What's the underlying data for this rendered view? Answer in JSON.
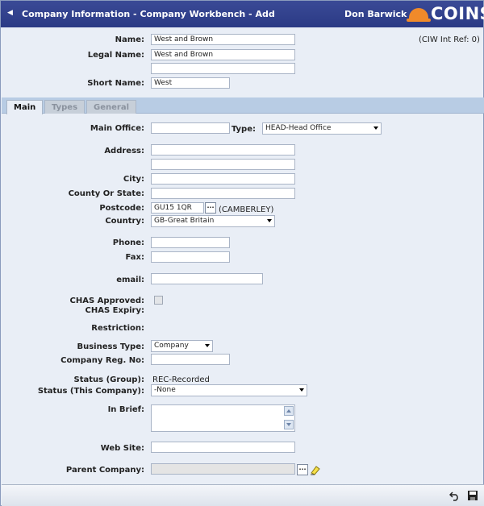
{
  "window": {
    "title": "Company Information - Company Workbench - Add",
    "user": "Don Barwick",
    "logo_text": "COINS",
    "back_icon": "left-triangle-icon"
  },
  "header_fields": {
    "name_label": "Name:",
    "name_value": "West and Brown",
    "legal_name_label": "Legal Name:",
    "legal_name_value": "West and Brown",
    "legal_name_line2": "",
    "short_name_label": "Short Name:",
    "short_name_value": "West",
    "ciw_ref": "(CIW Int Ref: 0)"
  },
  "tabs": [
    {
      "label": "Main"
    },
    {
      "label": "Types"
    },
    {
      "label": "General"
    }
  ],
  "main": {
    "main_office_label": "Main Office:",
    "main_office_value": "",
    "type_label": "Type:",
    "type_value": "HEAD-Head Office",
    "address_label": "Address:",
    "address_line1": "",
    "address_line2": "",
    "city_label": "City:",
    "city_value": "",
    "county_label": "County Or State:",
    "county_value": "",
    "postcode_label": "Postcode:",
    "postcode_value": "GU15 1QR",
    "postcode_lookup_label": "...",
    "postcode_area": "(CAMBERLEY)",
    "country_label": "Country:",
    "country_value": "GB-Great Britain",
    "phone_label": "Phone:",
    "phone_value": "",
    "fax_label": "Fax:",
    "fax_value": "",
    "email_label": "email:",
    "email_value": "",
    "chas_approved_label": "CHAS Approved:",
    "chas_approved_checked": false,
    "chas_expiry_label": "CHAS Expiry:",
    "restriction_label": "Restriction:",
    "business_type_label": "Business Type:",
    "business_type_value": "Company",
    "company_reg_label": "Company Reg. No:",
    "company_reg_value": "",
    "status_group_label": "Status (Group):",
    "status_group_value": "REC-Recorded",
    "status_company_label": "Status (This Company):",
    "status_company_value": "-None",
    "in_brief_label": "In Brief:",
    "in_brief_value": "",
    "web_site_label": "Web Site:",
    "web_site_value": "",
    "parent_company_label": "Parent Company:",
    "parent_company_value": "",
    "parent_lookup_label": "..."
  },
  "footer": {
    "undo_icon": "undo-icon",
    "save_icon": "save-icon"
  },
  "colors": {
    "titlebar": "#2b3a85",
    "logo_accent": "#f08a2a",
    "panel_background": "#e9eef6",
    "tabbar": "#b8cce4"
  }
}
